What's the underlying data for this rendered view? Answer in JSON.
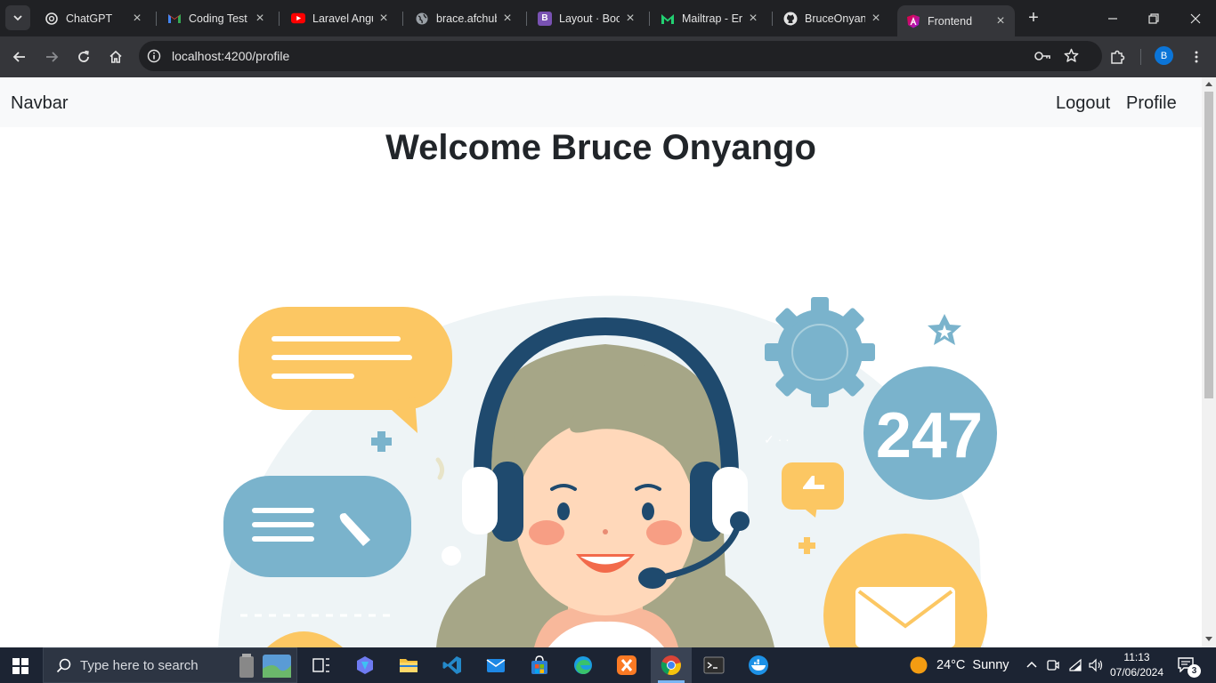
{
  "browser": {
    "tabs": [
      {
        "title": "ChatGPT",
        "icon": "chatgpt-icon"
      },
      {
        "title": "Coding Test",
        "icon": "gmail-icon"
      },
      {
        "title": "Laravel Angu",
        "icon": "youtube-icon"
      },
      {
        "title": "brace.afchub",
        "icon": "globe-icon"
      },
      {
        "title": "Layout · Boo",
        "icon": "bootstrap-icon"
      },
      {
        "title": "Mailtrap - Er",
        "icon": "mailtrap-icon"
      },
      {
        "title": "BruceOnyanc",
        "icon": "github-icon"
      },
      {
        "title": "Frontend",
        "icon": "angular-icon"
      }
    ],
    "active_tab": 7,
    "url": "localhost:4200/profile",
    "profile_initial": "B"
  },
  "page": {
    "navbar": {
      "brand": "Navbar",
      "links": [
        "Logout",
        "Profile"
      ]
    },
    "heading": "Welcome Bruce Onyango",
    "illustration": {
      "badge_text": "247"
    }
  },
  "taskbar": {
    "search_placeholder": "Type here to search",
    "weather": {
      "temp": "24°C",
      "condition": "Sunny"
    },
    "time": "11:13",
    "date": "07/06/2024",
    "notifications": "3"
  },
  "colors": {
    "chrome_dark": "#202124",
    "chrome_toolbar": "#35363a",
    "navbar_bg": "#f8f9fa",
    "illus_yellow": "#fcc763",
    "illus_blue": "#7ab3cc",
    "illus_navy": "#1f4a6e",
    "taskbar_bg": "#1c2433"
  }
}
